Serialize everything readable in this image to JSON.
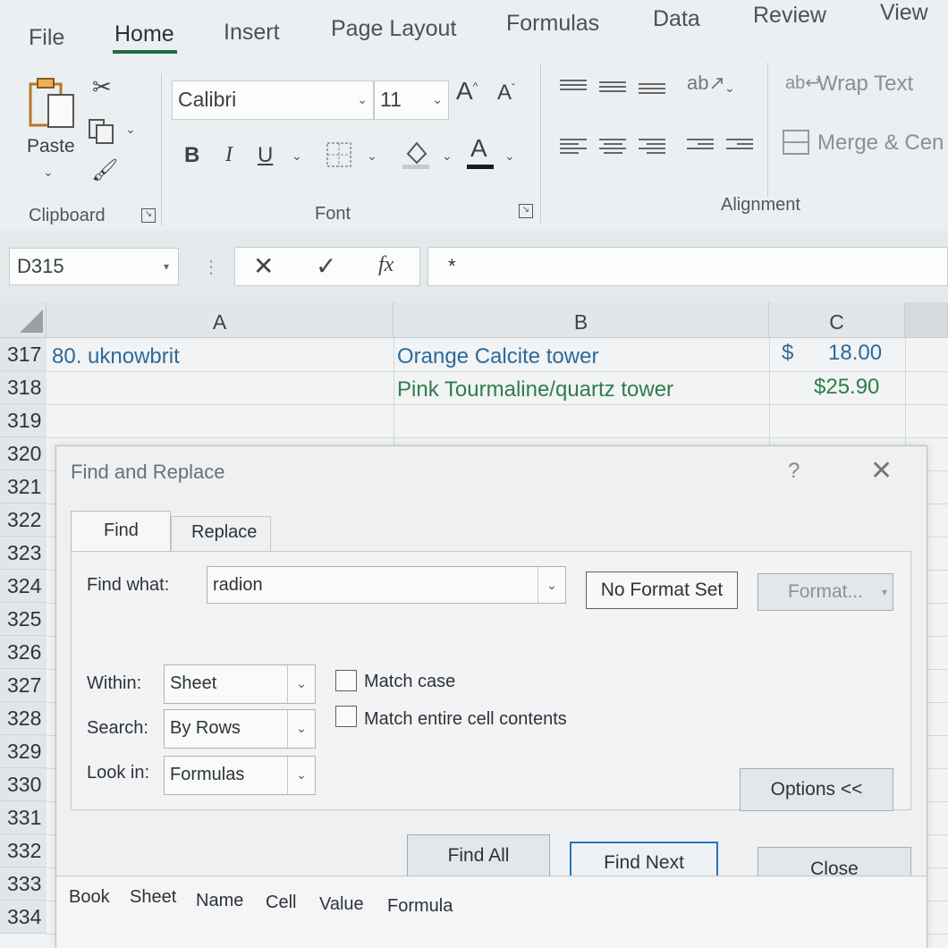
{
  "ribbon": {
    "tabs": [
      "File",
      "Home",
      "Insert",
      "Page Layout",
      "Formulas",
      "Data",
      "Review",
      "View"
    ],
    "clipboard": {
      "paste_label": "Paste",
      "group_label": "Clipboard"
    },
    "font": {
      "family": "Calibri",
      "size": "11",
      "bold": "B",
      "italic": "I",
      "underline": "U",
      "font_color_glyph": "A",
      "group_label": "Font"
    },
    "alignment": {
      "wrap_text": "Wrap Text",
      "merge_center": "Merge & Cen",
      "group_label": "Alignment"
    }
  },
  "formula_bar": {
    "name_box": "D315",
    "fx": "fx",
    "content": "*"
  },
  "columns": [
    "A",
    "B",
    "C"
  ],
  "rows": [
    {
      "num": "317",
      "a": "80. uknowbrit",
      "b": "Orange Calcite tower",
      "c_currency": "$",
      "c": "18.00"
    },
    {
      "num": "318",
      "a": "",
      "b": "Pink Tourmaline/quartz tower",
      "c_currency": "",
      "c": "$25.90"
    },
    {
      "num": "319"
    },
    {
      "num": "320"
    },
    {
      "num": "321"
    },
    {
      "num": "322"
    },
    {
      "num": "323"
    },
    {
      "num": "324"
    },
    {
      "num": "325"
    },
    {
      "num": "326"
    },
    {
      "num": "327"
    },
    {
      "num": "328"
    },
    {
      "num": "329"
    },
    {
      "num": "330"
    },
    {
      "num": "331"
    },
    {
      "num": "332"
    },
    {
      "num": "333"
    },
    {
      "num": "334"
    }
  ],
  "dialog": {
    "title": "Find and Replace",
    "help": "?",
    "tabs": [
      "Find",
      "Replace"
    ],
    "find_what_label": "Find what:",
    "find_what_value": "radion",
    "no_format_set": "No Format Set",
    "format_button": "Format...",
    "within_label": "Within:",
    "within_value": "Sheet",
    "search_label": "Search:",
    "search_value": "By Rows",
    "look_in_label": "Look in:",
    "look_in_value": "Formulas",
    "match_case": "Match case",
    "match_entire": "Match entire cell contents",
    "options_button": "Options <<",
    "find_all": "Find All",
    "find_next": "Find Next",
    "close": "Close",
    "results_columns": [
      "Book",
      "Sheet",
      "Name",
      "Cell",
      "Value",
      "Formula"
    ]
  },
  "colors": {
    "accent": "#1f6b45",
    "cell_blue": "#2d6a9a",
    "cell_green": "#2f7d4f",
    "dialog_focus": "#2b72c2"
  }
}
